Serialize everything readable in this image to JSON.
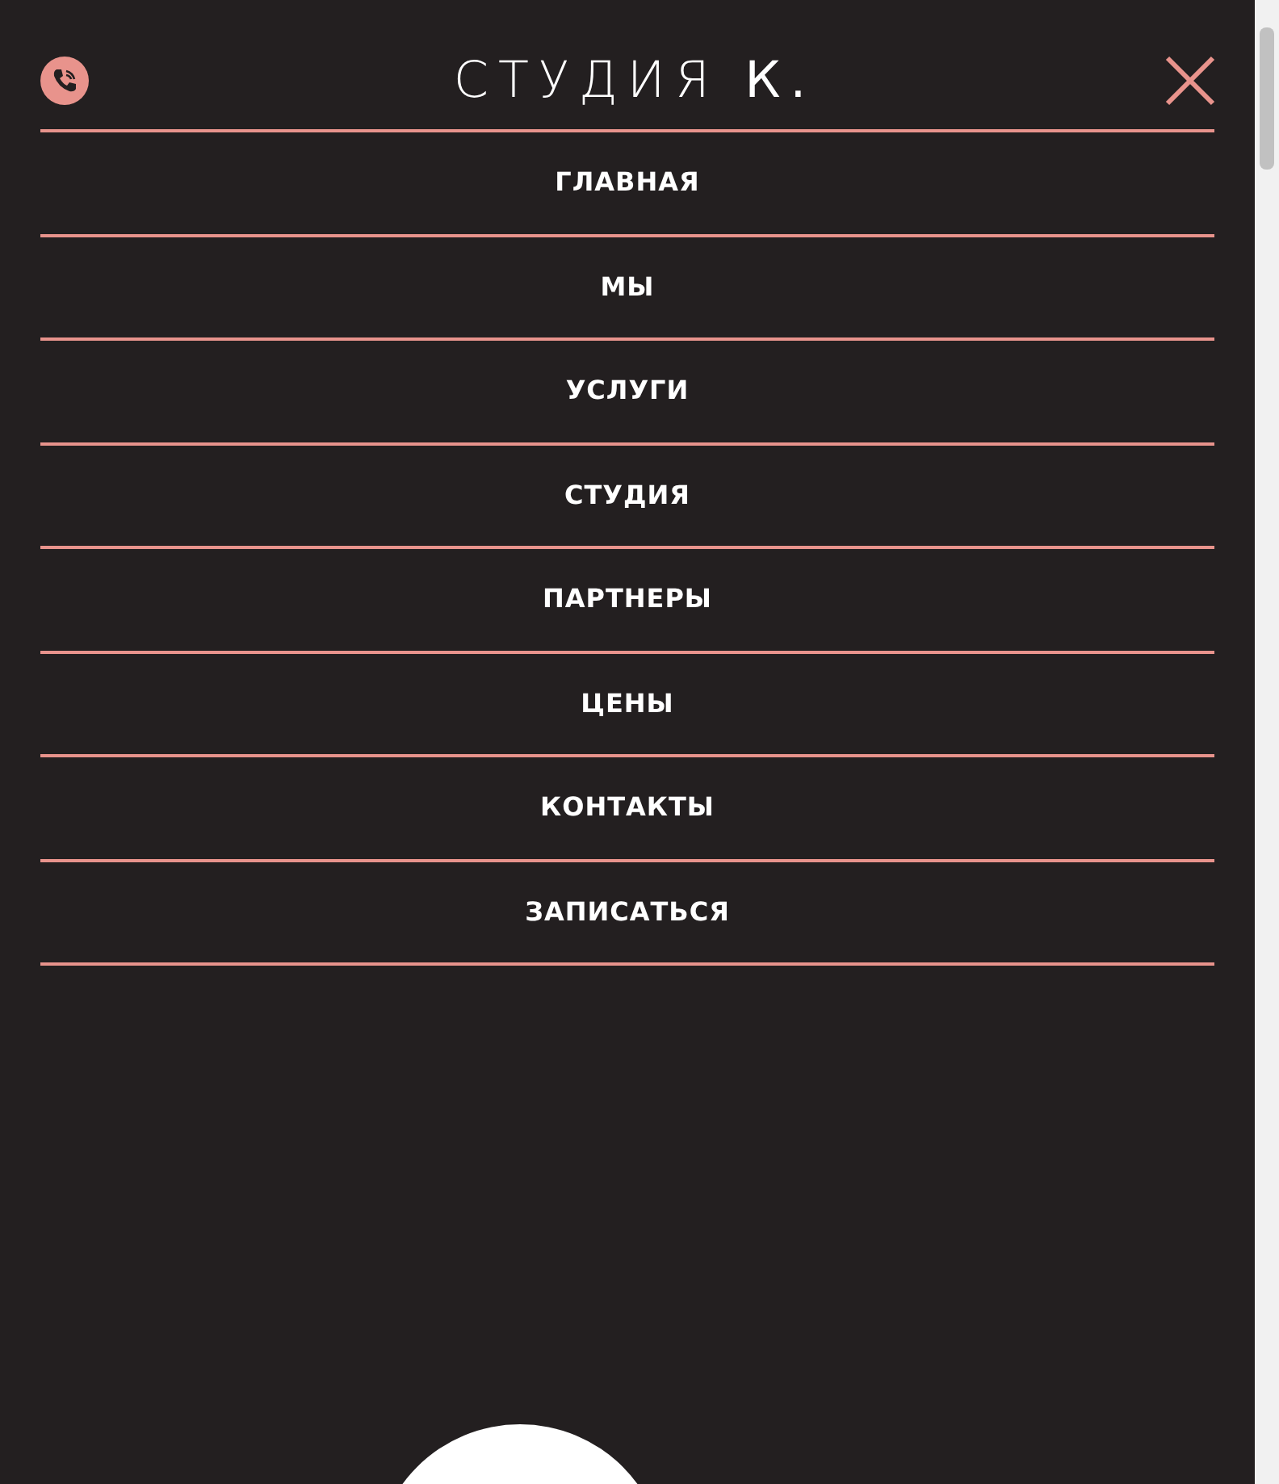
{
  "header": {
    "logo": "СТУДИЯ **К.**"
  },
  "menu": [
    {
      "label": "ГЛАВНАЯ"
    },
    {
      "label": "МЫ"
    },
    {
      "label": "УСЛУГИ"
    },
    {
      "label": "СТУДИЯ"
    },
    {
      "label": "ПАРТНЕРЫ"
    },
    {
      "label": "ЦЕНЫ"
    },
    {
      "label": "КОНТАКТЫ"
    },
    {
      "label": "ЗАПИСАТЬСЯ"
    }
  ]
}
